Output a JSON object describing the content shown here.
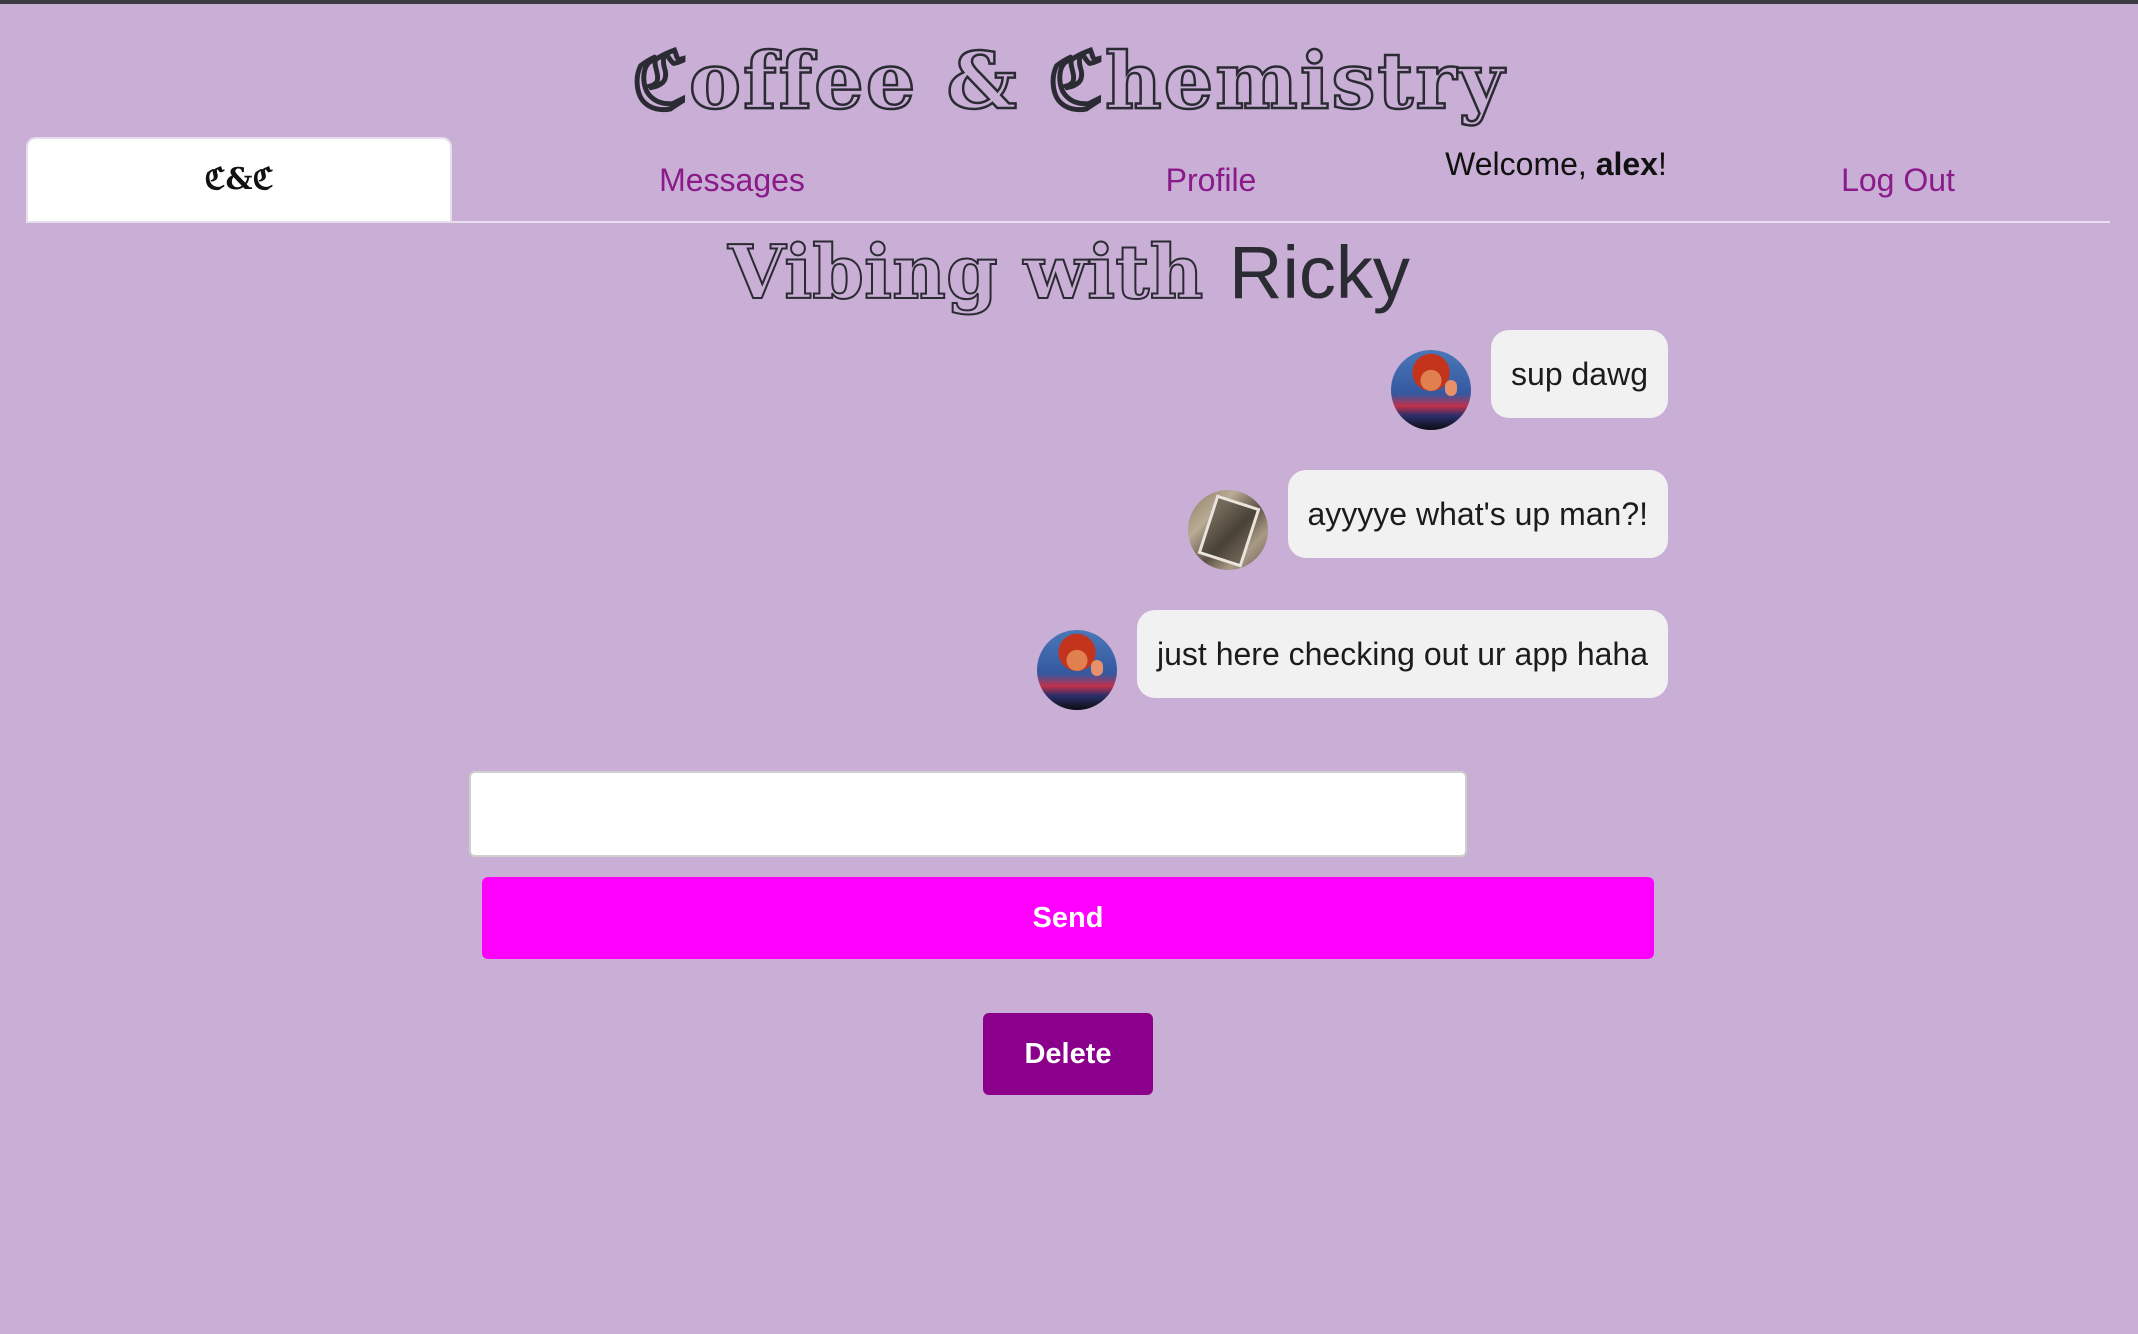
{
  "app": {
    "title": "ℭoffee & ℭhemistry"
  },
  "nav": {
    "home_label": "ℭ&ℭ",
    "messages_label": "Messages",
    "profile_label": "Profile",
    "welcome_prefix": "Welcome, ",
    "welcome_user": "alex",
    "welcome_suffix": "!",
    "logout_label": "Log Out"
  },
  "chat": {
    "heading_prefix": "Vibing with ",
    "partner_name": "Ricky",
    "messages": [
      {
        "text": "sup dawg",
        "avatar": "chucky-avatar"
      },
      {
        "text": "ayyyye what's up man?!",
        "avatar": "photo-avatar"
      },
      {
        "text": "just here checking out ur app haha",
        "avatar": "chucky-avatar"
      }
    ]
  },
  "composer": {
    "input_value": "",
    "send_label": "Send",
    "delete_label": "Delete"
  },
  "colors": {
    "background": "#c9aed5",
    "nav_link": "#8b1a8b",
    "send_button": "#ff00ff",
    "delete_button": "#8b008b",
    "bubble": "#f1f1f1"
  }
}
